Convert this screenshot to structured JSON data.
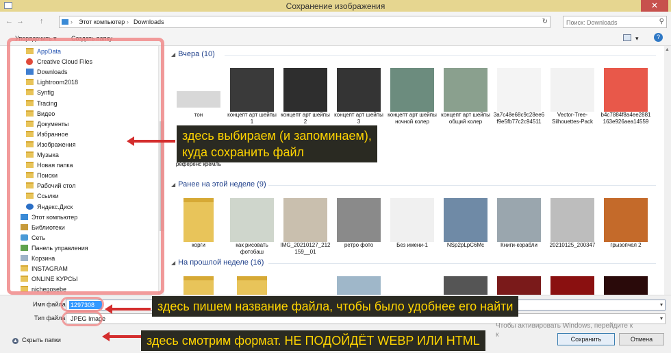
{
  "window": {
    "title": "Сохранение изображения",
    "close_glyph": "✕"
  },
  "address": {
    "back_glyph": "←",
    "forward_glyph": "→",
    "up_glyph": "↑",
    "crumbs": [
      "Этот компьютер",
      "Downloads"
    ],
    "separator": "›",
    "refresh_glyph": "↻"
  },
  "search": {
    "placeholder": "Поиск: Downloads",
    "icon": "search-icon"
  },
  "toolbar": {
    "organize": "Упорядочить ▾",
    "new_folder": "Создать папку",
    "view_glyph": "▾",
    "help_glyph": "?"
  },
  "sidebar": {
    "items": [
      {
        "label": "AppData",
        "icon": "folder"
      },
      {
        "label": "Creative Cloud Files",
        "icon": "cc"
      },
      {
        "label": "Downloads",
        "icon": "dl"
      },
      {
        "label": "Lightroom2018",
        "icon": "folder"
      },
      {
        "label": "Synfig",
        "icon": "folder"
      },
      {
        "label": "Tracing",
        "icon": "folder"
      },
      {
        "label": "Видео",
        "icon": "folder"
      },
      {
        "label": "Документы",
        "icon": "folder"
      },
      {
        "label": "Избранное",
        "icon": "folder"
      },
      {
        "label": "Изображения",
        "icon": "folder"
      },
      {
        "label": "Музыка",
        "icon": "folder"
      },
      {
        "label": "Новая папка",
        "icon": "folder"
      },
      {
        "label": "Поиски",
        "icon": "folder"
      },
      {
        "label": "Рабочий стол",
        "icon": "folder"
      },
      {
        "label": "Ссылки",
        "icon": "folder"
      },
      {
        "label": "Яндекс.Диск",
        "icon": "disk"
      },
      {
        "label": "Этот компьютер",
        "icon": "pc"
      },
      {
        "label": "Библиотеки",
        "icon": "lib"
      },
      {
        "label": "Сеть",
        "icon": "net"
      },
      {
        "label": "Панель управления",
        "icon": "cp"
      },
      {
        "label": "Корзина",
        "icon": "bin"
      },
      {
        "label": "INSTAGRAM",
        "icon": "folder"
      },
      {
        "label": "ONLINE КУРСЫ",
        "icon": "folder"
      },
      {
        "label": "nichegosebe",
        "icon": "folder"
      }
    ]
  },
  "content": {
    "groups": [
      {
        "header": "Вчера (10)",
        "files": [
          {
            "name": "тон",
            "color": "#d8d8d8"
          },
          {
            "name": "концепт арт шейпы 1",
            "color": "#3a3a3a"
          },
          {
            "name": "концепт арт шейпы 2",
            "color": "#2e2e2e"
          },
          {
            "name": "концепт арт шейпы 3",
            "color": "#343434"
          },
          {
            "name": "концепт арт шейпы ночной колер",
            "color": "#6c8c7e"
          },
          {
            "name": "концепт арт шейпы общий колер",
            "color": "#8aa08e"
          },
          {
            "name": "3a7c48e68c9c28ee6f9e5fb77c2c94511",
            "color": "#f4f4f4"
          },
          {
            "name": "Vector-Tree-Silhouettes-Pack",
            "color": "#f2f2f2"
          },
          {
            "name": "b4c7884f8a4ee2881163e926aea14559",
            "color": "#e8584a"
          },
          {
            "name": "референс кремль",
            "color": "#b8b8b8"
          }
        ]
      },
      {
        "header": "Ранее на этой неделе (9)",
        "files": [
          {
            "name": "корги",
            "color": "#e8c45a"
          },
          {
            "name": "как рисовать фотобаш",
            "color": "#cfd6cc"
          },
          {
            "name": "IMG_20210127_212159__01",
            "color": "#c9bfae"
          },
          {
            "name": "ретро фото",
            "color": "#8a8a8a"
          },
          {
            "name": "Без имени-1",
            "color": "#f0f0f0"
          },
          {
            "name": "NSp2pLpC6Mc",
            "color": "#6f8aa6"
          },
          {
            "name": "Книги-корабли",
            "color": "#9aa6ae"
          },
          {
            "name": "20210125_200347",
            "color": "#bdbdbd"
          },
          {
            "name": "грызопчел 2",
            "color": "#c46a2a"
          }
        ]
      },
      {
        "header": "На прошлой неделе (16)",
        "files": [
          {
            "name": "",
            "color": "#e8c45a"
          },
          {
            "name": "",
            "color": "#e8c45a"
          },
          {
            "name": "",
            "color": "#ffffff"
          },
          {
            "name": "",
            "color": "#9fb7c9"
          },
          {
            "name": "",
            "color": "#ffffff"
          },
          {
            "name": "",
            "color": "#555555"
          },
          {
            "name": "",
            "color": "#7a1a1a"
          },
          {
            "name": "",
            "color": "#8a1010"
          },
          {
            "name": "",
            "color": "#2a0a0a"
          }
        ]
      }
    ]
  },
  "bottom": {
    "filename_label": "Имя файла:",
    "filename_value": "1297308",
    "filetype_label": "Тип файла:",
    "filetype_value": "JPEG Image",
    "hide_folders": "Скрыть папки",
    "save": "Сохранить",
    "cancel": "Отмена",
    "watermark_line1": "Чтобы активировать Windows, перейдите к",
    "watermark_line2": "к"
  },
  "annotations": {
    "folder_note": [
      "здесь выбираем (и запоминаем),",
      "куда сохранить файл"
    ],
    "filename_note": "здесь пишем название файла, чтобы было удобнее его найти",
    "format_note": "здесь смотрим формат. НЕ ПОДОЙДЁТ WEBP ИЛИ HTML"
  }
}
